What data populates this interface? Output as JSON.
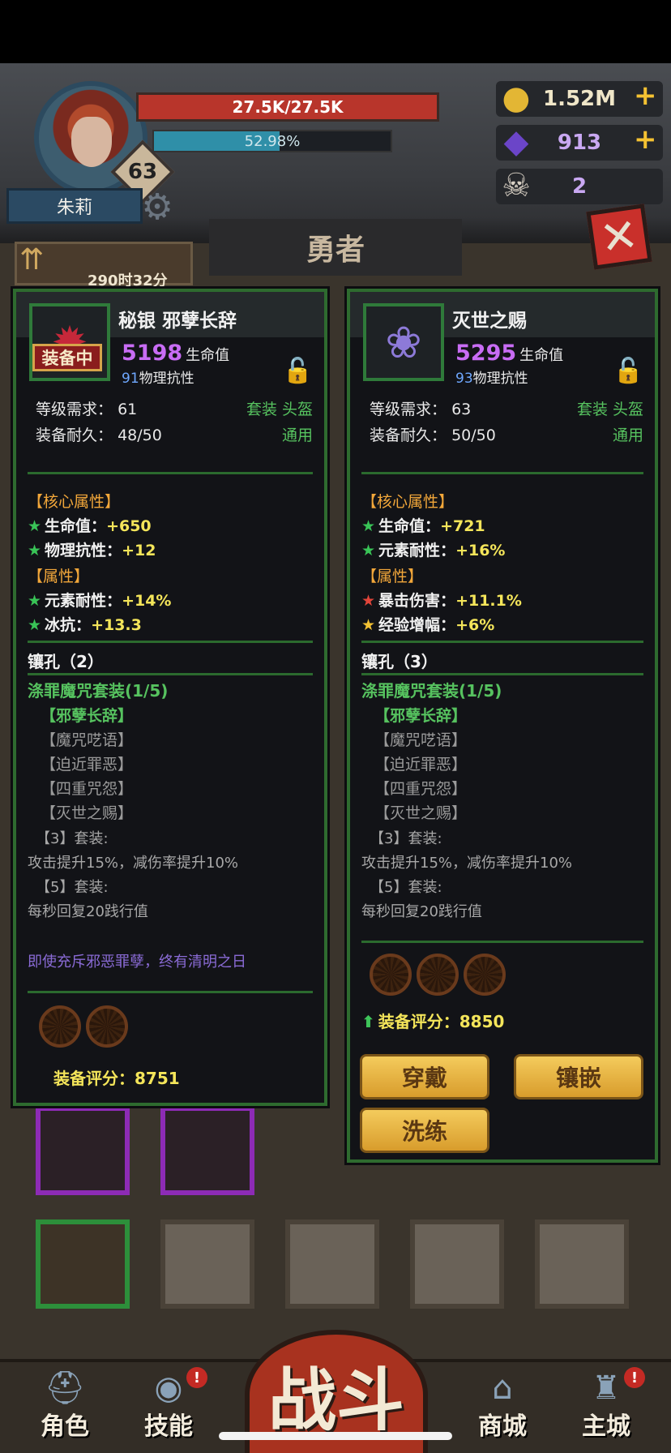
{
  "hero": {
    "name": "朱莉",
    "level": "63",
    "hp": "27.5K/27.5K",
    "exp": "52.98%",
    "exp_fraction": 0.5298
  },
  "resources": {
    "gold": "1.52M",
    "gems": "913",
    "skulls": "2"
  },
  "page_title": "勇者",
  "timer": "290时32分",
  "left_item": {
    "name": "秘银 邪孽长辞",
    "tag": "装备中",
    "main_value": "5198",
    "main_label": "生命值",
    "sub_value": "91",
    "sub_label": "物理抗性",
    "req_label": "等级需求：",
    "req_value": "61",
    "set_type": "套装 头盔",
    "durability_label": "装备耐久：",
    "durability_value": "48/50",
    "usage": "通用",
    "core_title": "【核心属性】",
    "core": [
      {
        "name": "生命值：",
        "value": "+650"
      },
      {
        "name": "物理抗性：",
        "value": "+12"
      }
    ],
    "attr_title": "【属性】",
    "attrs": [
      {
        "name": "元素耐性：",
        "value": "+14%"
      },
      {
        "name": "冰抗：",
        "value": "+13.3"
      }
    ],
    "sockets": "镶孔（2）",
    "set_name": "涤罪魔咒套装(1/5)",
    "set_items": [
      "【邪孽长辞】",
      "【魔咒呓语】",
      "【迫近罪恶】",
      "【四重咒怨】",
      "【灭世之赐】"
    ],
    "bonus3_title": "【3】套装:",
    "bonus3_text": "攻击提升15%，减伤率提升10%",
    "bonus5_title": "【5】套装:",
    "bonus5_text": "每秒回复20践行值",
    "flavor": "即使充斥邪恶罪孽，终有清明之日",
    "score_label": "装备评分：",
    "score_value": "8751"
  },
  "right_item": {
    "name": "灭世之赐",
    "main_value": "5295",
    "main_label": "生命值",
    "sub_value": "93",
    "sub_label": "物理抗性",
    "req_label": "等级需求：",
    "req_value": "63",
    "set_type": "套装 头盔",
    "durability_label": "装备耐久：",
    "durability_value": "50/50",
    "usage": "通用",
    "core_title": "【核心属性】",
    "core": [
      {
        "name": "生命值：",
        "value": "+721"
      },
      {
        "name": "元素耐性：",
        "value": "+16%"
      }
    ],
    "attr_title": "【属性】",
    "attrs": [
      {
        "name": "暴击伤害：",
        "value": "+11.1%"
      },
      {
        "name": "经验增幅：",
        "value": "+6%"
      }
    ],
    "sockets": "镶孔（3）",
    "set_name": "涤罪魔咒套装(1/5)",
    "set_items": [
      "【邪孽长辞】",
      "【魔咒呓语】",
      "【迫近罪恶】",
      "【四重咒怨】",
      "【灭世之赐】"
    ],
    "bonus3_title": "【3】套装:",
    "bonus3_text": "攻击提升15%，减伤率提升10%",
    "bonus5_title": "【5】套装:",
    "bonus5_text": "每秒回复20践行值",
    "score_label": "装备评分：",
    "score_value": "8850",
    "buttons": {
      "wear": "穿戴",
      "inlay": "镶嵌",
      "reforge": "洗练"
    }
  },
  "nav": {
    "role": "角色",
    "skills": "技能",
    "battle": "战斗",
    "shop": "商城",
    "city": "主城",
    "badge": "!"
  },
  "colors": {
    "hp": "#b8352b",
    "exp": "#2f8fa8",
    "panel_border": "#2e6b2f",
    "purple_value": "#c86cf4",
    "yellow_value": "#f4e55a",
    "green_text": "#56c25f"
  }
}
